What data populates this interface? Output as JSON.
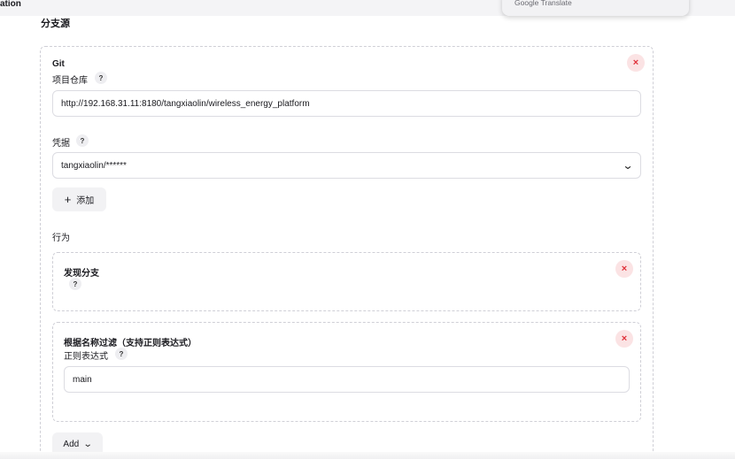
{
  "topbar": {
    "left_text": "ation"
  },
  "translate_popup": {
    "text": "Google Translate"
  },
  "section": {
    "title": "分支源"
  },
  "git": {
    "title": "Git",
    "repo_label": "项目仓库",
    "help": "?",
    "repo_url": "http://192.168.31.11:8180/tangxiaolin/wireless_energy_platform",
    "credentials_label": "凭据",
    "credentials_value": "tangxiaolin/******",
    "add_button": "添加",
    "behaviors_label": "行为",
    "close": "×"
  },
  "behaviors": [
    {
      "title": "发现分支",
      "help": "?",
      "close": "×"
    },
    {
      "title": "根据名称过滤（支持正则表达式）",
      "field_label": "正则表达式",
      "help": "?",
      "value": "main",
      "close": "×"
    }
  ],
  "add_menu": {
    "label": "Add"
  }
}
